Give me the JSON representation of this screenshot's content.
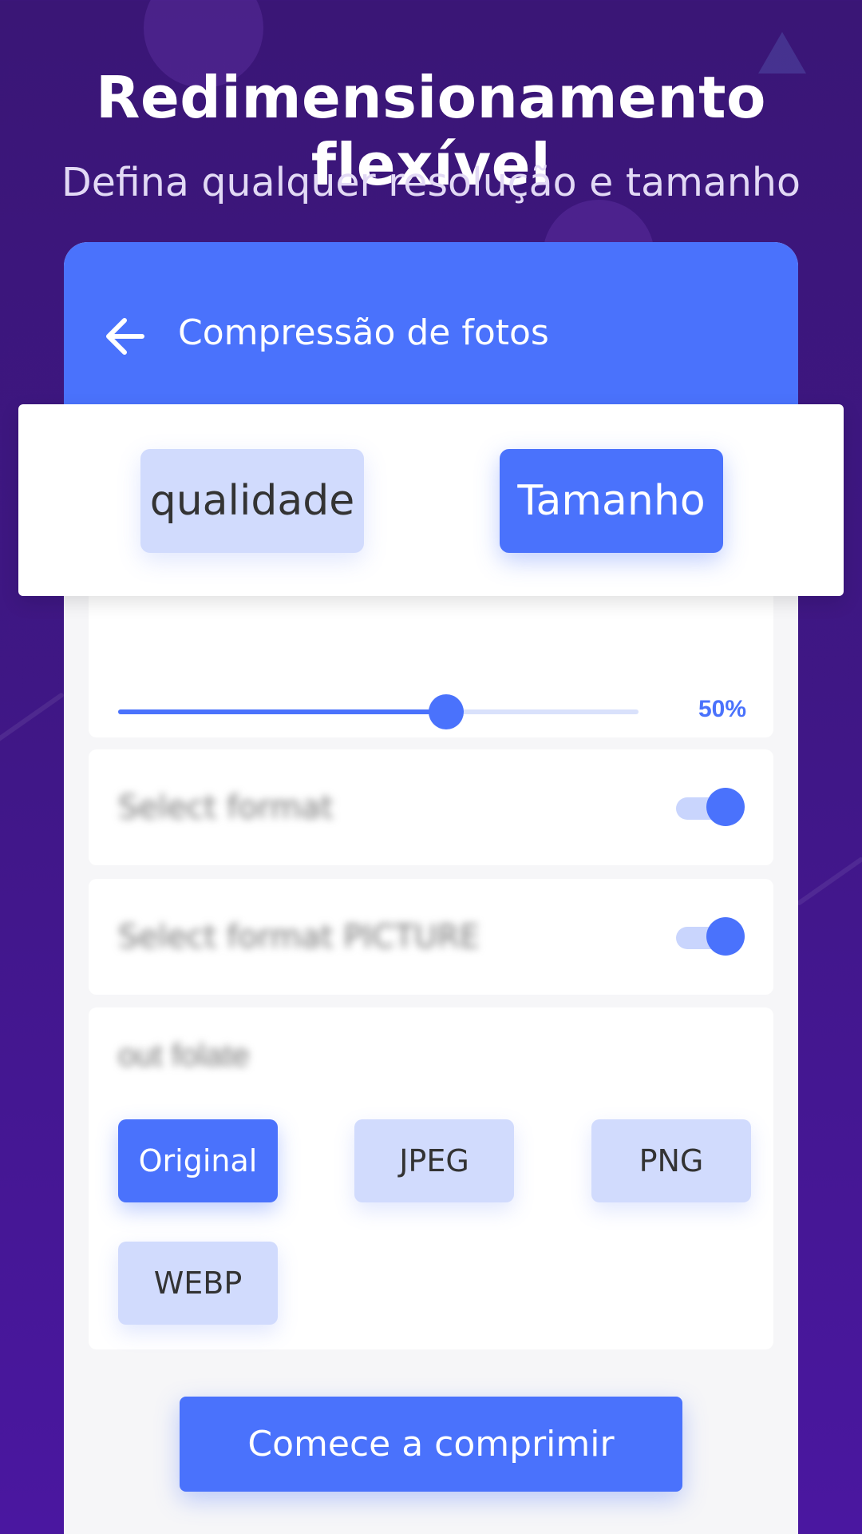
{
  "promo": {
    "title": "Redimensionamento flexível",
    "subtitle": "Defina qualquer resolução e tamanho"
  },
  "app_header": {
    "back_icon": "arrow-left-icon",
    "title": "Compressão de fotos"
  },
  "tabs": [
    {
      "label": "qualidade",
      "selected": false
    },
    {
      "label": "Tamanho",
      "selected": true
    }
  ],
  "slider": {
    "value_label": "50%",
    "fill_fraction": 0.63
  },
  "toggles": [
    {
      "label": "Select format",
      "on": true
    },
    {
      "label": "Select format PICTURE",
      "on": true
    }
  ],
  "format": {
    "heading": "out folate",
    "options": [
      {
        "label": "Original",
        "selected": true
      },
      {
        "label": "JPEG",
        "selected": false
      },
      {
        "label": "PNG",
        "selected": false
      },
      {
        "label": "WEBP",
        "selected": false
      }
    ]
  },
  "start_button": "Comece a comprimir",
  "colors": {
    "accent": "#4a72fc",
    "accent_light": "#d1dbfd",
    "background": "#3f1785"
  }
}
